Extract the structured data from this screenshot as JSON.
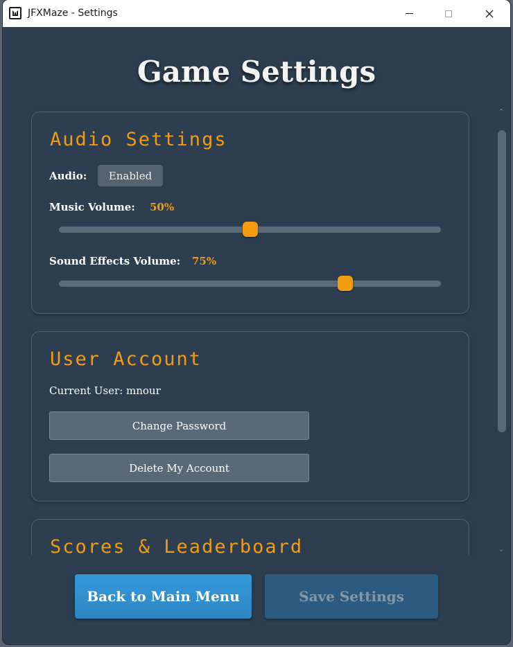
{
  "window": {
    "title": "JFXMaze - Settings"
  },
  "page": {
    "title": "Game Settings"
  },
  "audio": {
    "heading": "Audio Settings",
    "audio_label": "Audio:",
    "audio_toggle": "Enabled",
    "music_label": "Music Volume:",
    "music_value": "50%",
    "music_percent": 50,
    "sfx_label": "Sound Effects Volume:",
    "sfx_value": "75%",
    "sfx_percent": 75
  },
  "account": {
    "heading": "User Account",
    "current_user": "Current User: mnour",
    "change_password": "Change Password",
    "delete_account": "Delete My Account"
  },
  "scores": {
    "heading": "Scores & Leaderboard"
  },
  "footer": {
    "back": "Back to Main Menu",
    "save": "Save Settings"
  },
  "colors": {
    "background": "#2c3e50",
    "accent": "#f39c12",
    "primary_button": "#3498db",
    "disabled_button": "#2d5a80"
  }
}
